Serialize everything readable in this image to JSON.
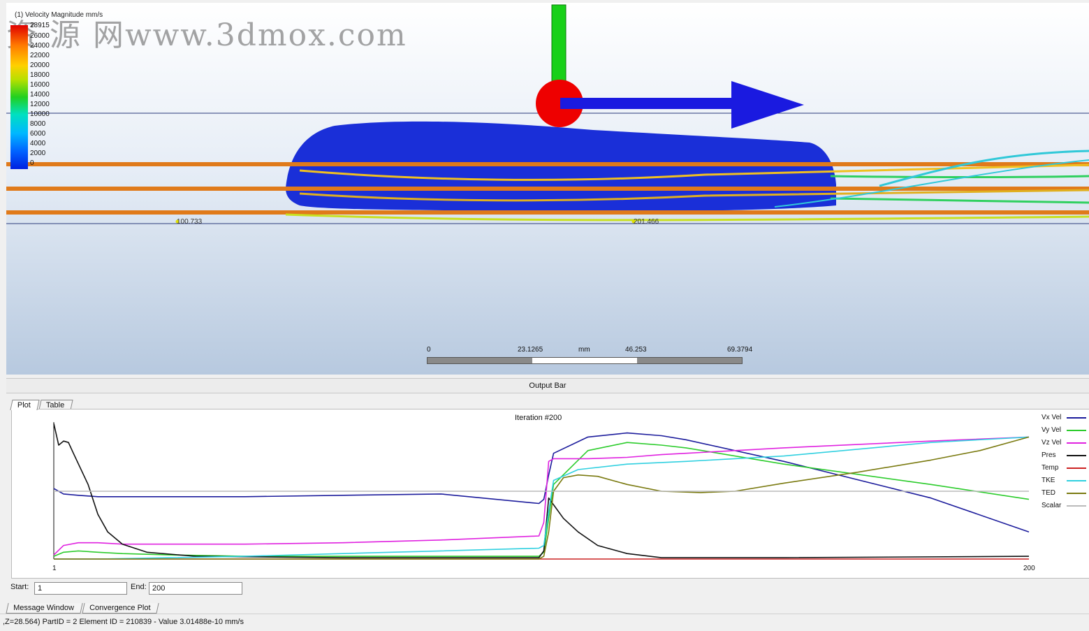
{
  "watermark": "资 源 网www.3dmox.com",
  "legend": {
    "title": "(1) Velocity Magnitude   mm/s",
    "max_value": "28915",
    "ticks": [
      "26000",
      "24000",
      "22000",
      "20000",
      "18000",
      "16000",
      "14000",
      "12000",
      "10000",
      "8000",
      "6000",
      "4000",
      "2000",
      "0"
    ]
  },
  "scale": {
    "labels": [
      "0",
      "23.1265",
      "mm",
      "46.253",
      "69.3794"
    ]
  },
  "probes": [
    "100.733",
    "201.466"
  ],
  "output_bar": {
    "title": "Output Bar"
  },
  "plot_tabs": [
    "Plot",
    "Table"
  ],
  "chart_data": {
    "type": "line",
    "title": "Iteration #200",
    "x_range": [
      1,
      200
    ],
    "x_tick_labels": [
      "1",
      "200"
    ],
    "series": [
      {
        "name": "Vx Vel",
        "color": "#1c1c9c",
        "x": [
          1,
          3,
          6,
          10,
          15,
          25,
          40,
          60,
          80,
          100,
          101,
          102,
          103,
          110,
          118,
          125,
          130,
          150,
          180,
          200
        ],
        "y": [
          0.52,
          0.48,
          0.47,
          0.46,
          0.46,
          0.46,
          0.46,
          0.47,
          0.48,
          0.41,
          0.44,
          0.62,
          0.78,
          0.9,
          0.93,
          0.91,
          0.88,
          0.72,
          0.45,
          0.2
        ]
      },
      {
        "name": "Vy Vel",
        "color": "#2ccc2c",
        "x": [
          1,
          3,
          6,
          10,
          15,
          25,
          40,
          60,
          80,
          100,
          101,
          102,
          103,
          110,
          118,
          125,
          130,
          150,
          180,
          200
        ],
        "y": [
          0.02,
          0.05,
          0.06,
          0.05,
          0.04,
          0.03,
          0.02,
          0.02,
          0.02,
          0.02,
          0.05,
          0.3,
          0.55,
          0.8,
          0.86,
          0.84,
          0.82,
          0.7,
          0.55,
          0.44
        ]
      },
      {
        "name": "Vz Vel",
        "color": "#e022e0",
        "x": [
          1,
          3,
          6,
          10,
          15,
          25,
          40,
          60,
          80,
          100,
          101,
          102,
          103,
          110,
          118,
          125,
          130,
          150,
          180,
          200
        ],
        "y": [
          0.03,
          0.1,
          0.12,
          0.12,
          0.11,
          0.11,
          0.11,
          0.12,
          0.14,
          0.17,
          0.27,
          0.72,
          0.74,
          0.74,
          0.75,
          0.77,
          0.78,
          0.82,
          0.87,
          0.9
        ]
      },
      {
        "name": "Pres",
        "color": "#111111",
        "x": [
          1,
          2,
          3,
          4,
          5,
          8,
          10,
          12,
          15,
          20,
          30,
          60,
          100,
          101,
          102,
          103,
          105,
          108,
          112,
          118,
          125,
          150,
          200
        ],
        "y": [
          1.0,
          0.84,
          0.87,
          0.86,
          0.78,
          0.55,
          0.33,
          0.2,
          0.11,
          0.05,
          0.02,
          0.01,
          0.01,
          0.06,
          0.45,
          0.4,
          0.3,
          0.2,
          0.1,
          0.04,
          0.01,
          0.01,
          0.02
        ]
      },
      {
        "name": "Temp",
        "color": "#cc2222",
        "x": [
          1,
          200
        ],
        "y": [
          0.0,
          0.0
        ]
      },
      {
        "name": "TKE",
        "color": "#30d0e0",
        "x": [
          1,
          10,
          25,
          40,
          60,
          80,
          100,
          101,
          102,
          103,
          108,
          118,
          130,
          150,
          180,
          200
        ],
        "y": [
          0.0,
          0.0,
          0.01,
          0.02,
          0.04,
          0.06,
          0.08,
          0.1,
          0.35,
          0.58,
          0.66,
          0.7,
          0.72,
          0.76,
          0.86,
          0.9
        ]
      },
      {
        "name": "TED",
        "color": "#7a7a10",
        "x": [
          1,
          30,
          100,
          101,
          102,
          103,
          105,
          108,
          112,
          118,
          125,
          133,
          140,
          150,
          165,
          180,
          190,
          200
        ],
        "y": [
          0.0,
          0.0,
          0.0,
          0.02,
          0.2,
          0.5,
          0.6,
          0.62,
          0.61,
          0.55,
          0.5,
          0.49,
          0.5,
          0.56,
          0.64,
          0.73,
          0.8,
          0.9
        ]
      },
      {
        "name": "Scalar",
        "color": "#bbbbbb",
        "x": [
          1,
          200
        ],
        "y": [
          0.5,
          0.5
        ]
      }
    ]
  },
  "range": {
    "start_label": "Start:",
    "start_value": "1",
    "end_label": "End:",
    "end_value": "200"
  },
  "bottom_tabs": [
    "Message Window",
    "Convergence Plot"
  ],
  "status": ",Z=28.564) PartID = 2 Element ID = 210839 - Value 3.01488e-10  mm/s"
}
